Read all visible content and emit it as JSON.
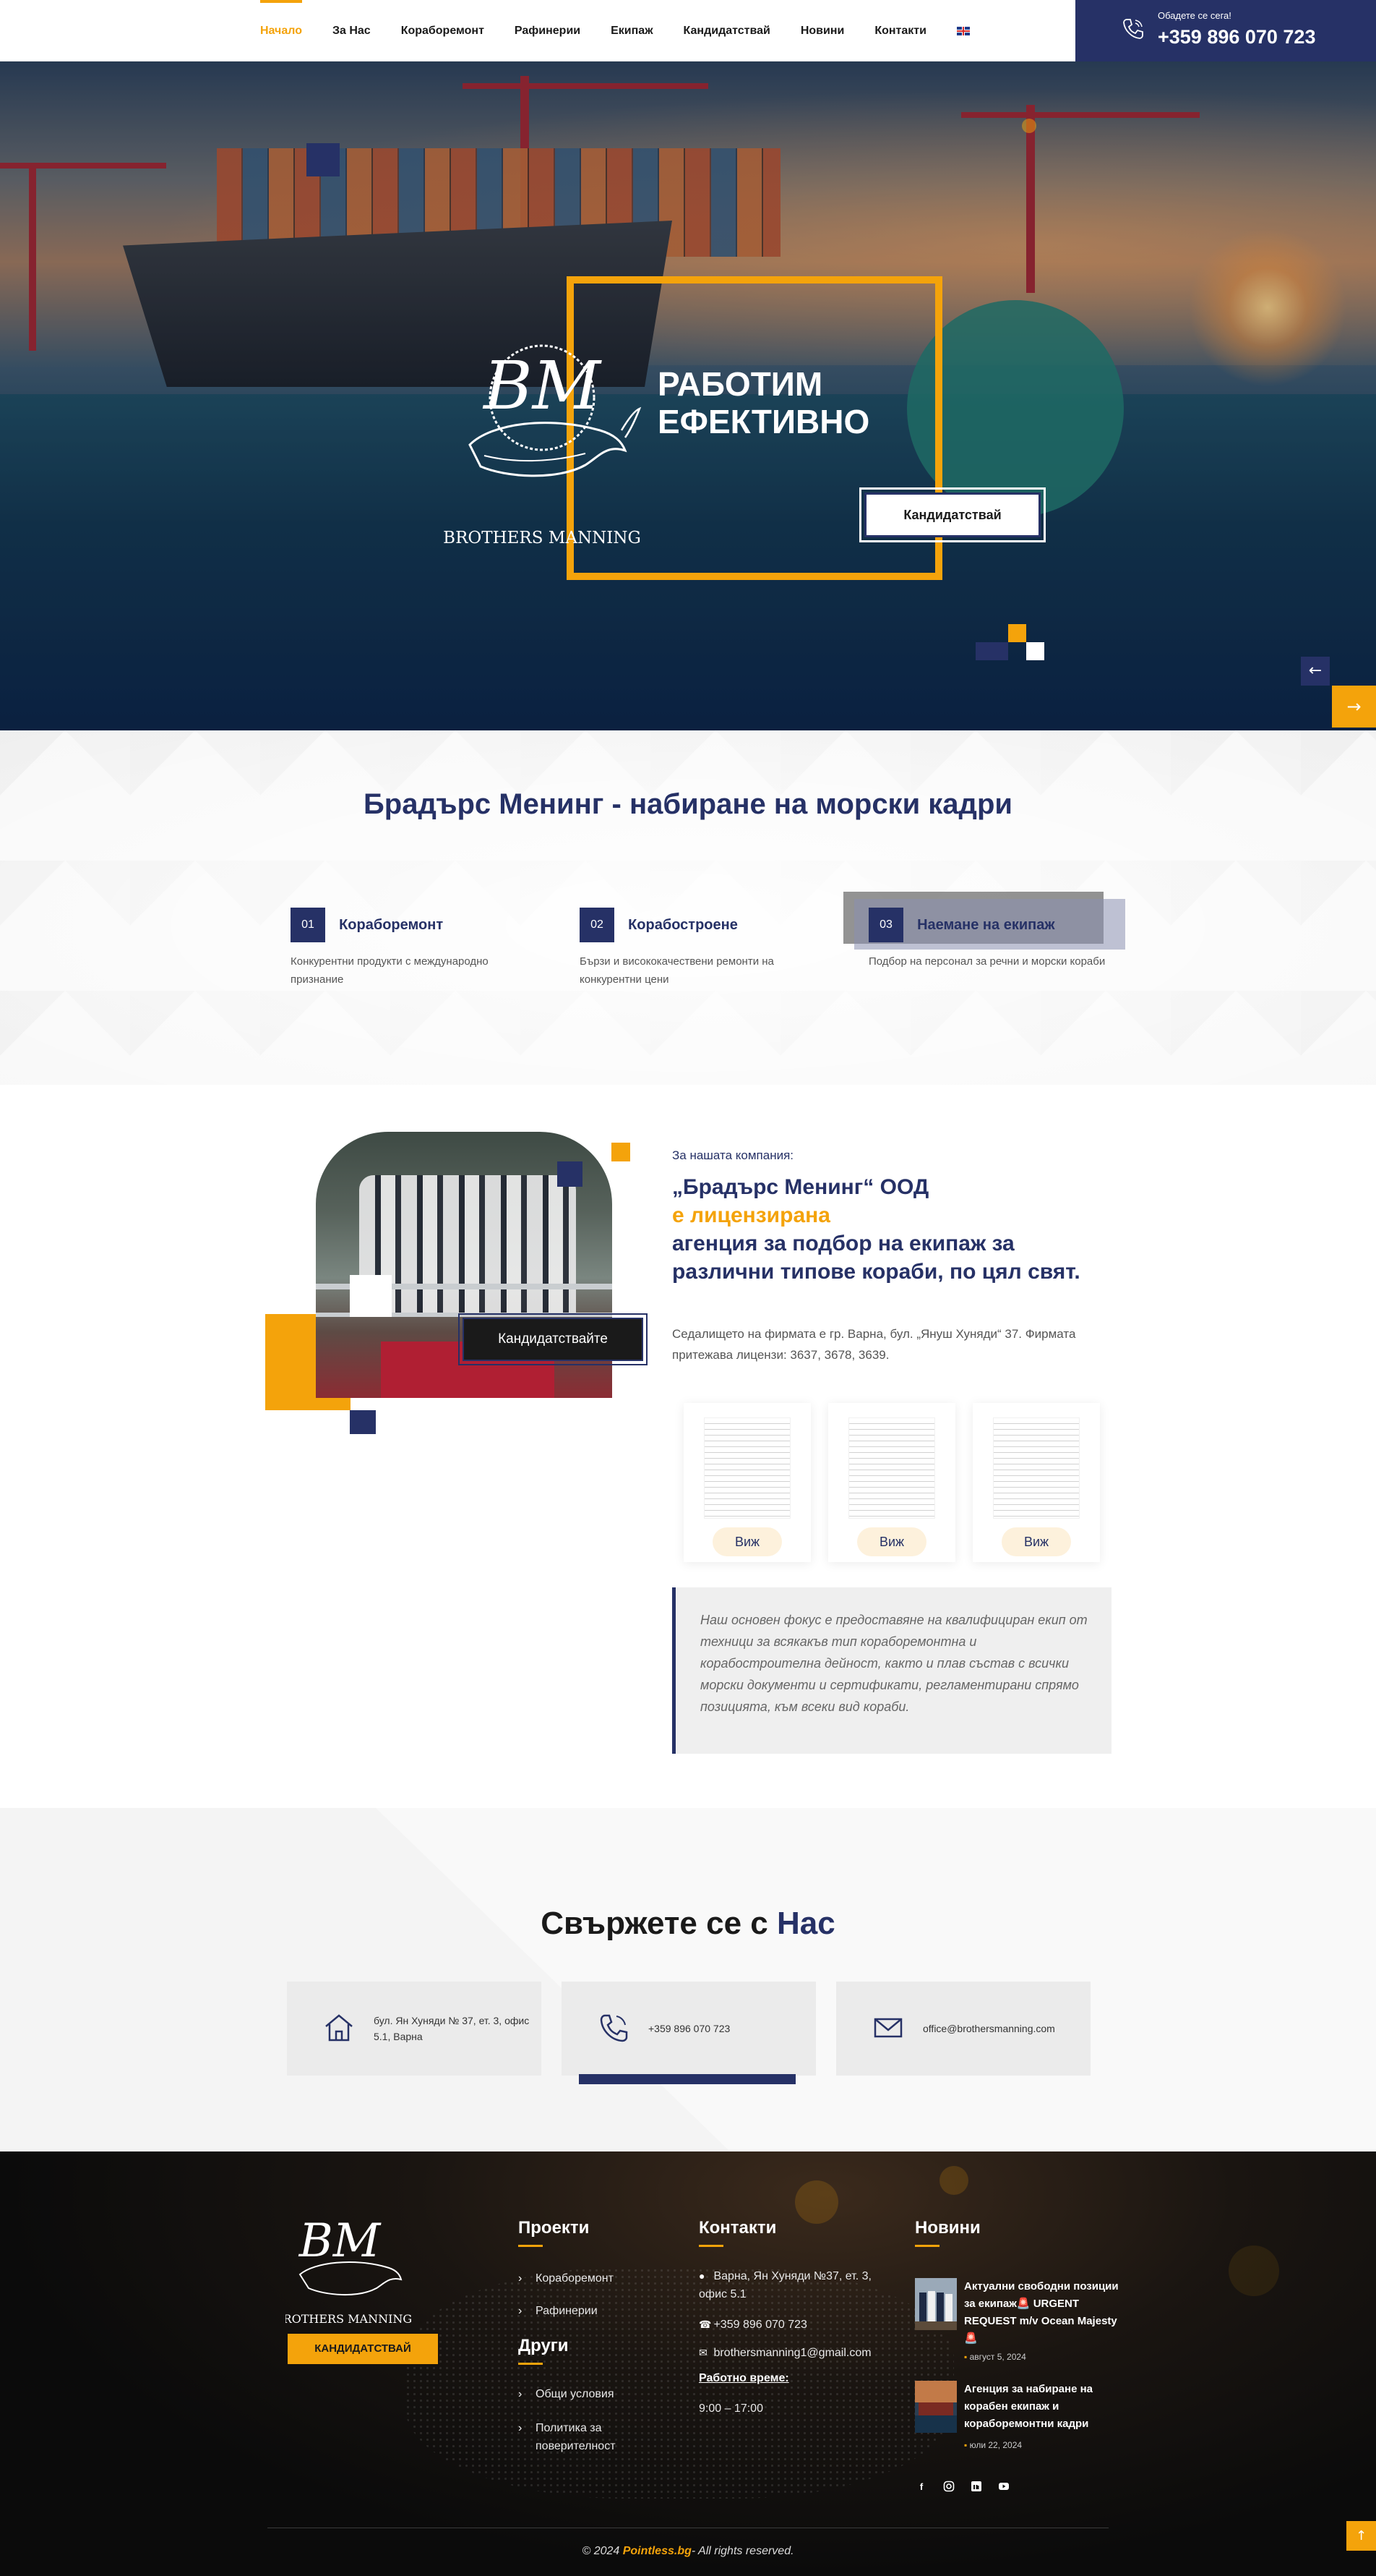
{
  "nav": {
    "items": [
      {
        "label": "Начало",
        "active": true
      },
      {
        "label": "За Нас"
      },
      {
        "label": "Кораборемонт"
      },
      {
        "label": "Рафинерии"
      },
      {
        "label": "Екипаж"
      },
      {
        "label": "Кандидатствай"
      },
      {
        "label": "Новини"
      },
      {
        "label": "Контакти"
      }
    ],
    "language_icon": "uk-flag-icon"
  },
  "callbox": {
    "label": "Обадете се сега!",
    "phone": "+359 896 070 723"
  },
  "hero": {
    "logo_text": "BROTHERS MANNING",
    "logo_monogram": "BM",
    "title_line1": "РАБОТИМ",
    "title_line2": "ЕФЕКТИВНО",
    "button": "Кандидатствай"
  },
  "intro": {
    "title": "Брадърс Менинг - набиране на морски кадри",
    "features": [
      {
        "num": "01",
        "title": "Кораборемонт",
        "desc": "Конкурентни продукти с международно признание"
      },
      {
        "num": "02",
        "title": "Корабостроене",
        "desc": "Бързи и висококачествени ремонти на конкурентни цени"
      },
      {
        "num": "03",
        "title": "Наемане на екипаж",
        "desc": "Подбор на персонал за речни и морски кораби"
      }
    ]
  },
  "about": {
    "photo_button": "Кандидатствайте",
    "subtitle": "За нашата компания:",
    "heading_part1": "„Брадърс Менинг“ ООД",
    "heading_accent": "е лицензирана",
    "heading_part2": "агенция за подбор на екипаж за различни типове кораби, по цял свят.",
    "description": "Седалището на фирмата е гр. Варна, бул. „Януш Хуняди“ 37. Фирмата притежава лицензи: 3637, 3678, 3639.",
    "licenses": [
      {
        "button": "Виж"
      },
      {
        "button": "Виж"
      },
      {
        "button": "Виж"
      }
    ],
    "quote": "Наш основен фокус е предоставяне на квалифициран екип от техници за всякакъв тип кораборемонтна и корабостроителна дейност, както и плав състав с всички морски документи и сертификати, регламентирани спрямо позицията, към всеки вид кораби."
  },
  "contact": {
    "title_part1": "Свържете се с",
    "title_accent": "Нас",
    "items": [
      {
        "icon": "home-icon",
        "text": "бул. Ян Хуняди № 37, ет. 3, офис 5.1, Варна"
      },
      {
        "icon": "phone-icon",
        "text": "+359 896 070 723"
      },
      {
        "icon": "mail-icon",
        "text": "office@brothersmanning.com"
      }
    ]
  },
  "footer": {
    "logo_text": "BROTHERS MANNING",
    "logo_monogram": "BM",
    "button": "КАНДИДАТСТВАЙ",
    "projects": {
      "title": "Проекти",
      "links": [
        "Кораборемонт",
        "Рафинерии"
      ]
    },
    "others": {
      "title": "Други",
      "links": [
        "Общи условия",
        "Политика за поверителност"
      ]
    },
    "contacts": {
      "title": "Контакти",
      "address": "Варна, Ян Хуняди №37, ет. 3, офис 5.1",
      "phone": "+359 896 070 723",
      "email": "brothersmanning1@gmail.com",
      "hours_label": "Работно време:",
      "hours": "9:00 – 17:00"
    },
    "news": {
      "title": "Новини",
      "items": [
        {
          "title": "Актуални свободни позиции за екипаж🚨 URGENT REQUEST m/v Ocean Majesty🚨",
          "date": "август 5, 2024"
        },
        {
          "title": "Агенция за набиране на корабен екипаж и кораборемонтни кадри",
          "date": "юли 22, 2024"
        }
      ]
    },
    "socials": [
      "facebook-icon",
      "instagram-icon",
      "linkedin-icon",
      "youtube-icon"
    ],
    "copyright_prefix": "© 2024",
    "copyright_brand": "Pointless.bg",
    "copyright_suffix": "- All rights reserved."
  },
  "colors": {
    "navy": "#263166",
    "accent": "#f4a30b",
    "footer_bg": "#0b0b0b"
  }
}
